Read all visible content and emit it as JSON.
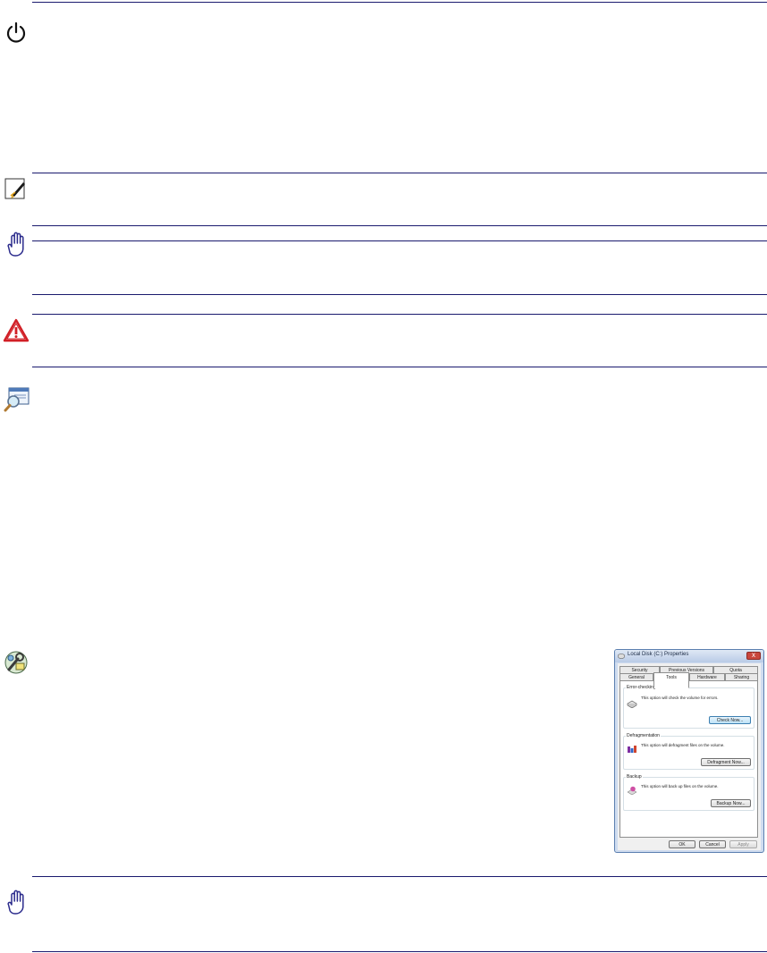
{
  "page": {
    "icons": [
      "power-icon",
      "note-icon",
      "caution-hand-icon",
      "warning-icon",
      "magnifier-icon",
      "tools-icon",
      "caution-hand-icon"
    ]
  },
  "dialog": {
    "title": "Local Disk (C:) Properties",
    "close_label": "x",
    "tabs_row1": [
      "Security",
      "Previous Versions",
      "Quota"
    ],
    "tabs_row2": [
      "General",
      "Tools",
      "Hardware",
      "Sharing"
    ],
    "active_tab": "Tools",
    "groups": {
      "error": {
        "label": "Error-checking",
        "text": "This option will check the volume for errors.",
        "button": "Check Now..."
      },
      "defrag": {
        "label": "Defragmentation",
        "text": "This option will defragment files on the volume.",
        "button": "Defragment Now..."
      },
      "backup": {
        "label": "Backup",
        "text": "This option will back up files on the volume.",
        "button": "Backup Now..."
      }
    },
    "footer": {
      "ok": "OK",
      "cancel": "Cancel",
      "apply": "Apply"
    }
  }
}
